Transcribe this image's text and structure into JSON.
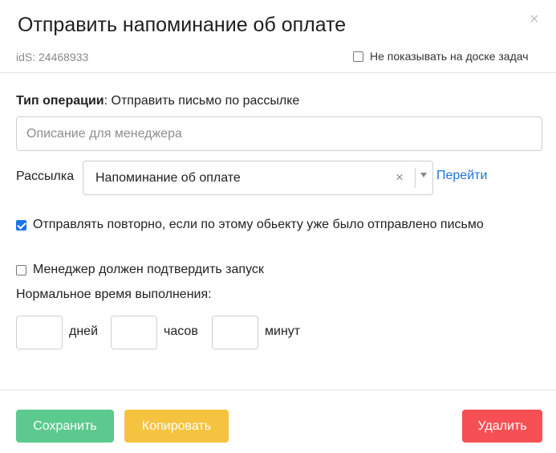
{
  "dialog": {
    "title": "Отправить напоминание об оплате",
    "close_symbol": "×",
    "ids": "idS: 24468933",
    "hide_on_board_label": "Не показывать на доске задач",
    "hide_on_board_checked": false
  },
  "operation": {
    "type_label": "Тип операции",
    "type_value": ": Отправить письмо по рассылке"
  },
  "description": {
    "placeholder": "Описание для менеджера",
    "value": ""
  },
  "mailing": {
    "label": "Рассылка",
    "selected": "Напоминание об оплате",
    "clear_symbol": "×",
    "goto_link": "Перейти"
  },
  "resend": {
    "label": "Отправлять повторно, если по этому обьекту уже было отправлено письмо",
    "checked": true
  },
  "confirm": {
    "label": "Менеджер должен подтвердить запуск",
    "checked": false
  },
  "normal_time": {
    "label": "Нормальное время выполнения:",
    "days_label": "дней",
    "hours_label": "часов",
    "minutes_label": "минут",
    "days_value": "",
    "hours_value": "",
    "minutes_value": ""
  },
  "buttons": {
    "save": "Сохранить",
    "copy": "Копировать",
    "delete": "Удалить"
  },
  "colors": {
    "accent": "#1a73e8",
    "link": "#1d72d8",
    "save": "#5cc98e",
    "copy": "#f5c33f",
    "delete": "#f65054"
  }
}
